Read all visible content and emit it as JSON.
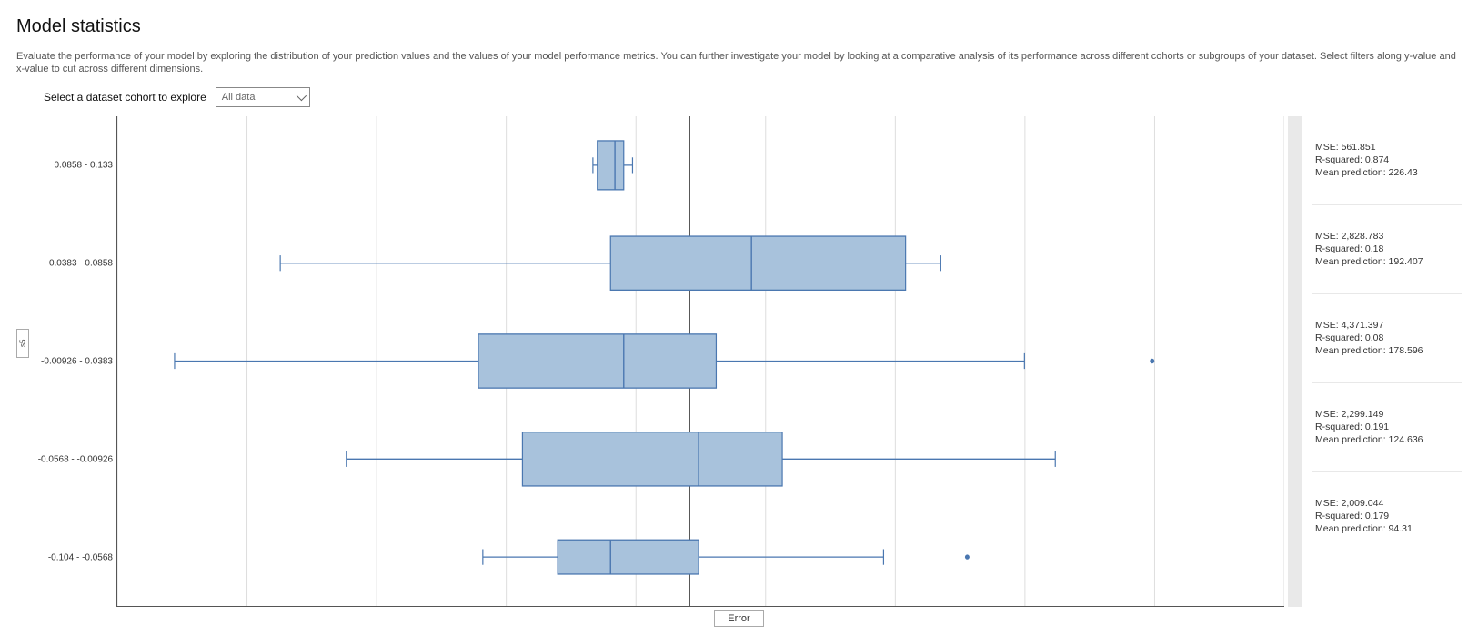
{
  "title": "Model statistics",
  "description": "Evaluate the performance of your model by exploring the distribution of your prediction values and the values of your model performance metrics. You can further investigate your model by looking at a comparative analysis of its performance across different cohorts or subgroups of your dataset. Select filters along y-value and x-value to cut across different dimensions.",
  "cohort_label": "Select a dataset cohort to explore",
  "cohort_selected": "All data",
  "yaxis_button": "s5",
  "xaxis_button": "Error",
  "chart_data": {
    "type": "boxplot-h",
    "xlabel": "Error",
    "ylabel": "s5",
    "x_range": [
      -130,
      135
    ],
    "vline_at": 0,
    "categories": [
      "0.0858 - 0.133",
      "0.0383 - 0.0858",
      "-0.00926 - 0.0383",
      "-0.0568 - -0.00926",
      "-0.104 - -0.0568"
    ],
    "boxes": [
      {
        "whisker_lo": -22,
        "q1": -21,
        "median": -17,
        "q3": -15,
        "whisker_hi": -13,
        "height": 0.5,
        "outliers": []
      },
      {
        "whisker_lo": -93,
        "q1": -18,
        "median": 14,
        "q3": 49,
        "whisker_hi": 57,
        "height": 0.55,
        "outliers": []
      },
      {
        "whisker_lo": -117,
        "q1": -48,
        "median": -15,
        "q3": 6,
        "whisker_hi": 76,
        "height": 0.55,
        "outliers": [
          105
        ]
      },
      {
        "whisker_lo": -78,
        "q1": -38,
        "median": 2,
        "q3": 21,
        "whisker_hi": 83,
        "height": 0.55,
        "outliers": []
      },
      {
        "whisker_lo": -47,
        "q1": -30,
        "median": -18,
        "q3": 2,
        "whisker_hi": 44,
        "height": 0.35,
        "outliers": [
          63
        ]
      }
    ],
    "metrics": [
      {
        "mse": "561.851",
        "r2": "0.874",
        "mean_pred": "226.43"
      },
      {
        "mse": "2,828.783",
        "r2": "0.18",
        "mean_pred": "192.407"
      },
      {
        "mse": "4,371.397",
        "r2": "0.08",
        "mean_pred": "178.596"
      },
      {
        "mse": "2,299.149",
        "r2": "0.191",
        "mean_pred": "124.636"
      },
      {
        "mse": "2,009.044",
        "r2": "0.179",
        "mean_pred": "94.31"
      }
    ]
  },
  "labels": {
    "mse": "MSE:",
    "r2": "R-squared:",
    "mean_pred": "Mean prediction:"
  }
}
